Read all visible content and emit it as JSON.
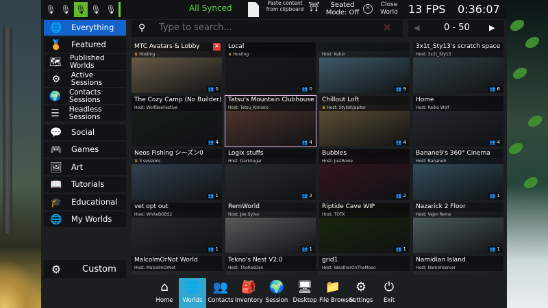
{
  "status": {
    "sync_label": "All Synced",
    "paste_label": "Paste content from clipboard",
    "seated_label": "Seated Mode: Off",
    "close_world_label": "Close World",
    "fps": "13 FPS",
    "clock": "0:36:07",
    "icons": [
      "mic-muted-icon",
      "mic-icon",
      "mic-active-icon",
      "mic-icon",
      "mic-broadcast-icon"
    ]
  },
  "sidebar": {
    "items": [
      {
        "label": "Everything",
        "icon": "globe-icon",
        "selected": true
      },
      {
        "label": "Featured",
        "icon": "medal-icon"
      },
      {
        "label": "Published Worlds",
        "icon": "globe-list-icon"
      },
      {
        "label": "Active Sessions",
        "icon": "cog-group-icon"
      },
      {
        "label": "Contacts Sessions",
        "icon": "contacts-globe-icon"
      },
      {
        "label": "Headless Sessions",
        "icon": "server-icon"
      },
      {
        "label": "Social",
        "icon": "chat-icon"
      },
      {
        "label": "Games",
        "icon": "gamepad-icon"
      },
      {
        "label": "Art",
        "icon": "easel-icon"
      },
      {
        "label": "Tutorials",
        "icon": "book-icon"
      },
      {
        "label": "Educational",
        "icon": "grad-cap-icon"
      },
      {
        "label": "My Worlds",
        "icon": "user-globe-icon"
      }
    ],
    "custom_label": "Custom"
  },
  "search": {
    "placeholder": "Type to search...",
    "range": "0 - 50"
  },
  "worlds": [
    {
      "title": "MTC Avatars & Lobby",
      "host": "Hosting",
      "crown": true,
      "count": "0",
      "close": true,
      "bg": "#7a6a52"
    },
    {
      "title": "Local",
      "host": "Hosting",
      "crown": true,
      "count": "0",
      "bg": "#1a1c1e"
    },
    {
      "title": "",
      "host": "Host: Kukio",
      "crown": false,
      "count": "9",
      "bg": "#4a6a7a"
    },
    {
      "title": "3x1t_Sty13's scratch space",
      "host": "Host: 3x1t_Sty13",
      "crown": false,
      "count": "6",
      "bg": "#3a4a52"
    },
    {
      "title": "The Cozy Camp (No Builder)",
      "host": "Host: WolfBeeFestive",
      "crown": false,
      "count": "4",
      "bg": "#16201a"
    },
    {
      "title": "Tatsu's Mountain Clubhouse",
      "host": "Host: Tatsu_Kimiero",
      "crown": false,
      "count": "4",
      "selected": true,
      "bg": "#5a3a32"
    },
    {
      "title": "Chillout Loft",
      "host": "Host: StylishJupiter",
      "crown": true,
      "count": "4",
      "bg": "#6a5a3a"
    },
    {
      "title": "Home",
      "host": "Host: Reiko Wolf",
      "crown": false,
      "count": "4",
      "bg": "#2a2a34"
    },
    {
      "title": "Neos Fishing シーズン0",
      "host": "3 sessions",
      "crown": true,
      "count": "1",
      "bg": "#3a4a5a"
    },
    {
      "title": "Logix stuffs",
      "host": "Host: DarkSugar",
      "crown": false,
      "count": "2",
      "bg": "#2c3238"
    },
    {
      "title": "Bubbles",
      "host": "Host: JustRoxie",
      "crown": false,
      "count": "2",
      "bg": "#3a1420"
    },
    {
      "title": "Banane9's 360° Cinema",
      "host": "Host: Banane9",
      "crown": false,
      "count": "1",
      "bg": "#3a5a6a"
    },
    {
      "title": "vet opt out",
      "host": "Host: WhiteBGBS2",
      "crown": false,
      "count": "1",
      "bg": "#2c3034"
    },
    {
      "title": "RemWorld",
      "host": "Host: Joe Sylvo",
      "crown": false,
      "count": "1",
      "bg": "#6a6a6a"
    },
    {
      "title": "Riptide Cave WIP",
      "host": "Host: TOTK",
      "crown": false,
      "count": "1",
      "bg": "#1a2a0a"
    },
    {
      "title": "Nazarick 2 Floor",
      "host": "Host: Vajor Remo",
      "crown": false,
      "count": "1",
      "bg": "#5a6a6e"
    },
    {
      "title": "MalcolmOrNot World",
      "host": "Host: MalcolmOrNot",
      "crown": false,
      "count": "",
      "bg": "#2c3034"
    },
    {
      "title": "Tekno's Nest V2.0",
      "host": "Host: TheRosDen",
      "crown": false,
      "count": "",
      "bg": "#2c3034"
    },
    {
      "title": "grid1",
      "host": "Host: WeatherOnTheMoon",
      "crown": false,
      "count": "",
      "bg": "#2c3034"
    },
    {
      "title": "Namidian Island",
      "host": "Host: Namimserver",
      "crown": false,
      "count": "",
      "bg": "#2c3034"
    }
  ],
  "dock": [
    {
      "label": "Home",
      "icon": "home-icon"
    },
    {
      "label": "Worlds",
      "icon": "worlds-globe-icon",
      "active": true
    },
    {
      "label": "Contacts",
      "icon": "contacts-icon"
    },
    {
      "label": "Inventory",
      "icon": "backpack-icon"
    },
    {
      "label": "Session",
      "icon": "session-globe-icon"
    },
    {
      "label": "Desktop",
      "icon": "monitor-icon"
    },
    {
      "label": "File Browser",
      "icon": "folder-icon"
    },
    {
      "label": "Settings",
      "icon": "gear-icon"
    },
    {
      "label": "Exit",
      "icon": "power-icon"
    }
  ]
}
